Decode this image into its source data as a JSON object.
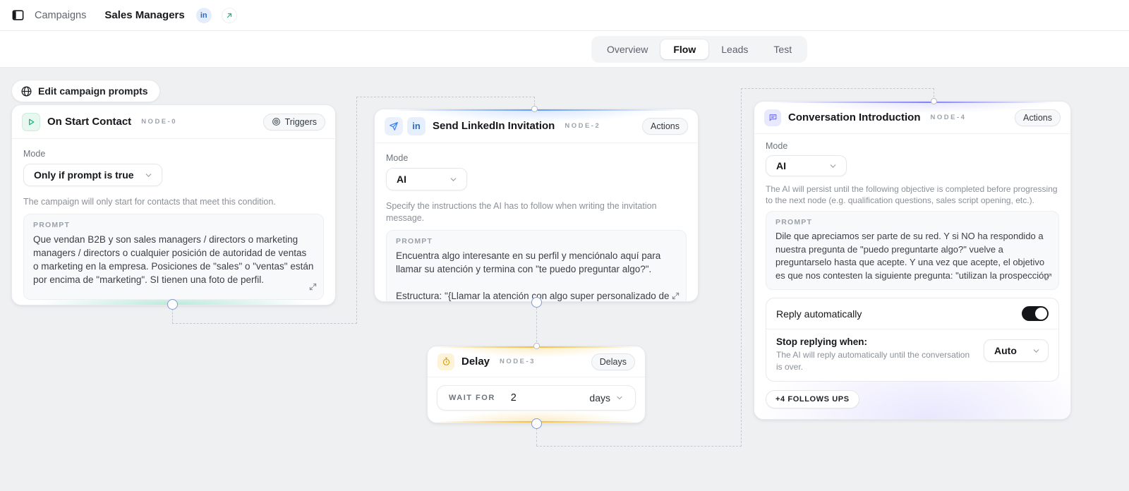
{
  "topbar": {
    "breadcrumb": "Campaigns",
    "title": "Sales Managers",
    "linkedin_badge": "in"
  },
  "tabs": {
    "items": [
      {
        "label": "Overview"
      },
      {
        "label": "Flow"
      },
      {
        "label": "Leads"
      },
      {
        "label": "Test"
      }
    ],
    "active": "Flow"
  },
  "canvas": {
    "edit_button_label": "Edit campaign prompts"
  },
  "nodes": {
    "node0": {
      "title": "On Start Contact",
      "id_label": "NODE-0",
      "badge": "Triggers",
      "mode_label": "Mode",
      "mode_value": "Only if prompt is true",
      "helper": "The campaign will only start for contacts that meet this condition.",
      "prompt_label": "PROMPT",
      "prompt": "Que vendan B2B y son sales managers / directors o marketing managers / directors o cualquier posición de autoridad de ventas o marketing en la empresa. Posiciones de \"sales\" o \"ventas\" están por encima de \"marketing\". SI tienen una foto de perfil."
    },
    "node2": {
      "title": "Send LinkedIn Invitation",
      "id_label": "NODE-2",
      "badge": "Actions",
      "mode_label": "Mode",
      "mode_value": "AI",
      "helper": "Specify the instructions the AI has to follow when writing the invitation message.",
      "prompt_label": "PROMPT",
      "prompt": "Encuentra algo interesante en su perfil y menciónalo aquí para llamar su atención y termina con \"te puedo preguntar algo?\".\n\nEstructura: \"{Llamar la atención con algo super personalizado de su"
    },
    "node3": {
      "title": "Delay",
      "id_label": "NODE-3",
      "badge": "Delays",
      "wait_label": "WAIT FOR",
      "wait_value": "2",
      "wait_unit": "days"
    },
    "node4": {
      "title": "Conversation Introduction",
      "id_label": "NODE-4",
      "badge": "Actions",
      "mode_label": "Mode",
      "mode_value": "AI",
      "helper": "The AI will persist until the following objective is completed before progressing to the next node (e.g. qualification questions, sales script opening, etc.).",
      "prompt_label": "PROMPT",
      "prompt": "Dile que apreciamos ser parte de su red. Y si NO ha respondido a nuestra pregunta de \"puedo preguntarte algo?\" vuelve a preguntarselo hasta que acepte. Y una vez que acepte, el objetivo es que nos contesten la siguiente pregunta: \"utilizan la prospección",
      "reply": {
        "title": "Reply automatically",
        "toggle_on": true,
        "stop_label": "Stop replying when:",
        "stop_helper": "The AI will reply automatically until the conversation is over.",
        "stop_value": "Auto"
      },
      "followups_badge": "+4 FOLLOWS UPS"
    }
  },
  "colors": {
    "trigger_green": "#10b981",
    "action_blue": "#3b82f6",
    "delay_amber": "#f0b429",
    "conversation_purple": "#6d6af8",
    "linkedin_blue": "#2f6bc0"
  }
}
